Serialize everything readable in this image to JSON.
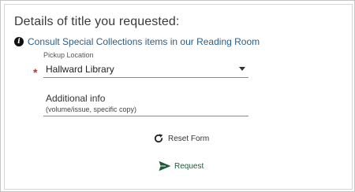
{
  "form": {
    "title": "Details of title you requested:",
    "info_link": "Consult Special Collections items in our Reading Room",
    "pickup": {
      "label": "Pickup Location",
      "value": "Hallward Library",
      "required_mark": "*"
    },
    "additional_info": {
      "label": "Additional info",
      "hint": "(volume/issue, specific copy)"
    },
    "reset_label": "Reset Form",
    "request_label": "Request"
  },
  "icons": {
    "info": "info-icon",
    "dropdown": "chevron-down-icon",
    "reset": "reset-icon",
    "request": "send-icon"
  },
  "colors": {
    "link": "#2d5d84",
    "required": "#cf2b2b",
    "request": "#1d5a3a",
    "title": "#3a3a3a"
  }
}
